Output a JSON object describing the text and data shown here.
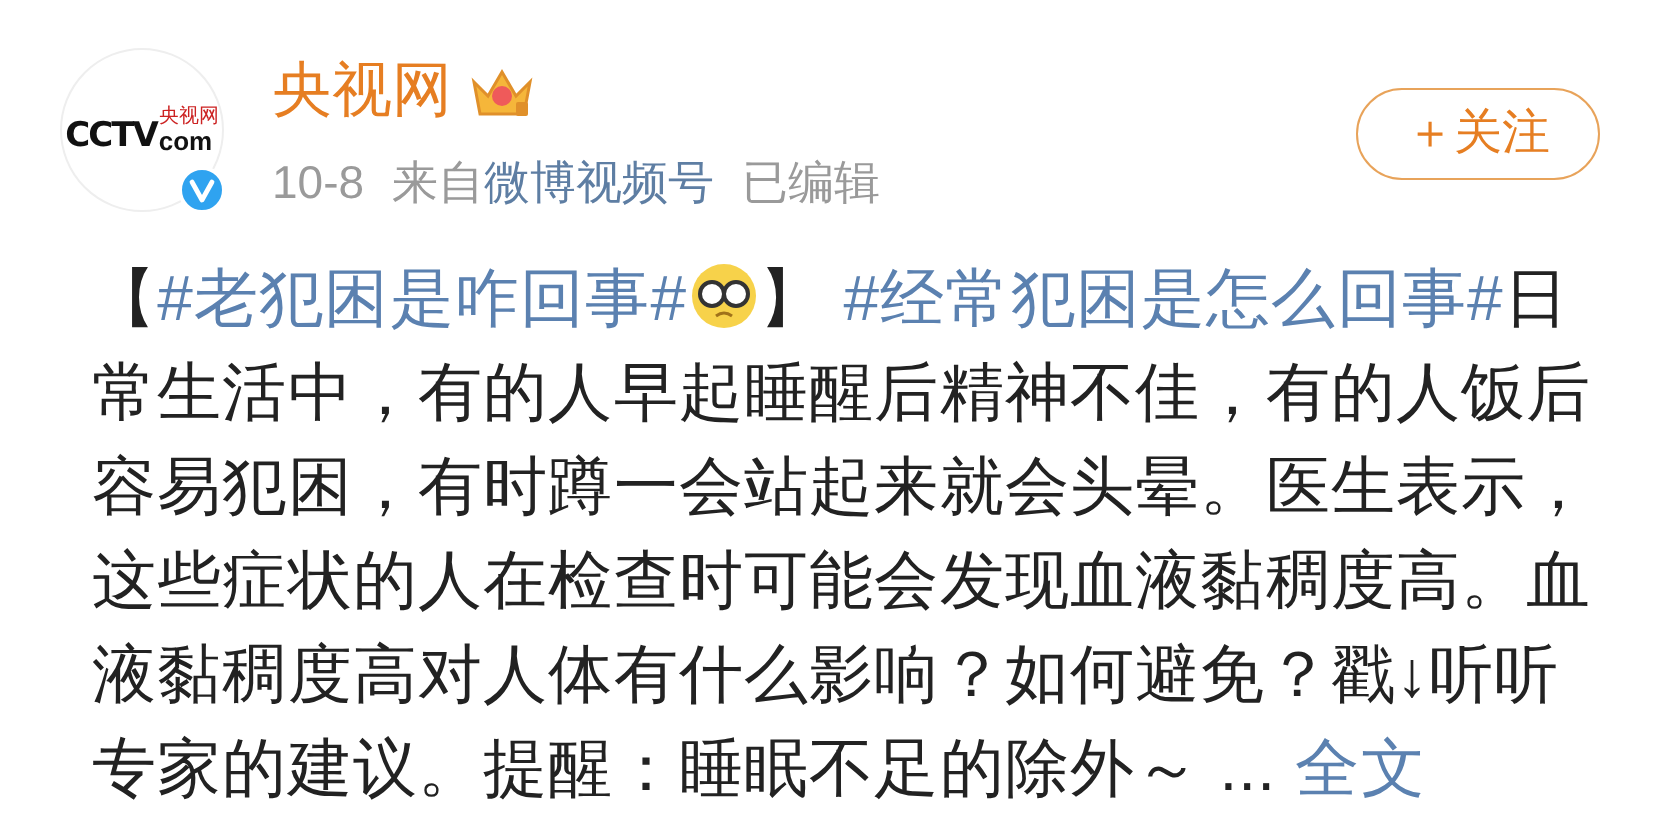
{
  "author": {
    "name": "央视网",
    "avatar": {
      "logo": "CCTV",
      "domain": "com",
      "caption": "央视网",
      "verified": true
    },
    "vip_crown": true
  },
  "meta": {
    "date": "10-8",
    "source_prefix": "来自",
    "source": "微博视频号",
    "edited": "已编辑"
  },
  "follow_button": "＋关注",
  "body": [
    {
      "kind": "text",
      "text": "【"
    },
    {
      "kind": "hashtag",
      "text": "#老犯困是咋回事#"
    },
    {
      "kind": "emoji"
    },
    {
      "kind": "text",
      "text": "】 "
    },
    {
      "kind": "hashtag",
      "text": "#经常犯困是怎么回事#"
    },
    {
      "kind": "text",
      "text": "日常生活中，有的人早起睡醒后精神不佳，有的人饭后容易犯困，有时蹲一会站起来就会头晕。医生表示，这些症状的人在检查时可能会发现血液黏稠度高。血液黏稠度高对人体有什么影响？如何避免？戳↓听听专家的建议。提醒：睡眠不足的除外～ ... "
    },
    {
      "kind": "link",
      "text": "全文"
    }
  ]
}
